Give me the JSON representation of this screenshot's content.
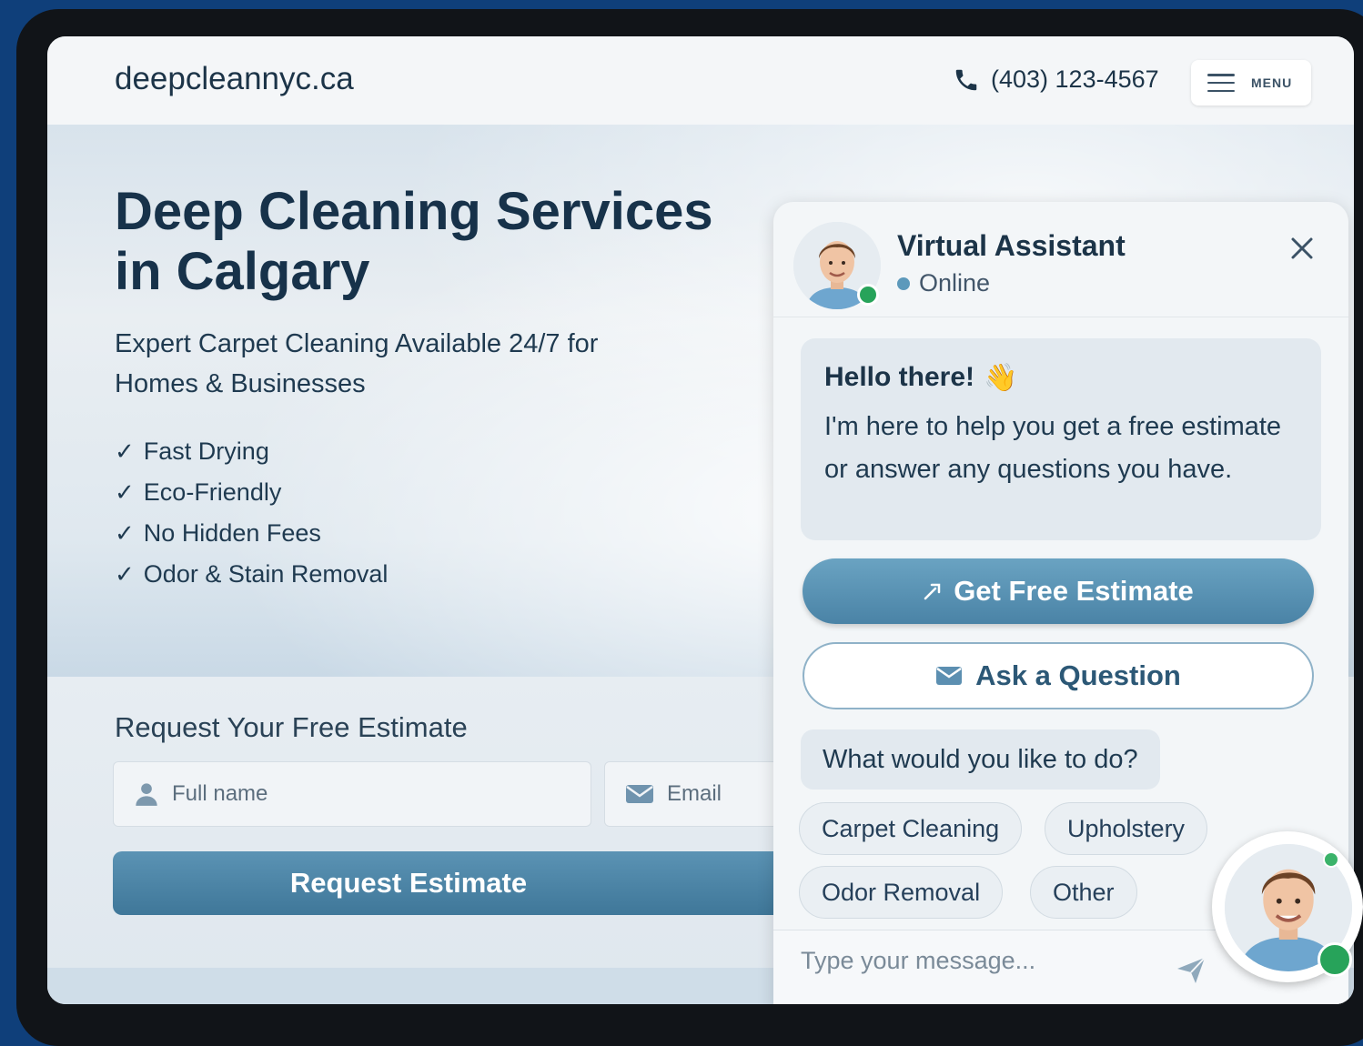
{
  "header": {
    "logo": "deepcleannyc.ca",
    "phone": "(403) 123-4567",
    "menu_label": "MENU"
  },
  "hero": {
    "title": "Deep Cleaning Services in Calgary",
    "subtitle": "Expert Carpet Cleaning Available 24/7 for Homes & Businesses",
    "features": [
      "Fast Drying",
      "Eco-Friendly",
      "No Hidden Fees",
      "Odor & Stain Removal"
    ]
  },
  "estimate_form": {
    "title": "Request Your Free Estimate",
    "name_placeholder": "Full name",
    "email_placeholder": "Email",
    "submit_label": "Request Estimate"
  },
  "chat": {
    "title": "Virtual Assistant",
    "status": "Online",
    "greeting": "Hello there!",
    "greeting_emoji": "👋",
    "message": "I'm here to help you get a free estimate or answer any questions you have.",
    "primary_button": "Get Free Estimate",
    "secondary_button": "Ask a Question",
    "prompt": "What would you like to do?",
    "options": [
      "Carpet Cleaning",
      "Upholstery",
      "Odor Removal",
      "Other"
    ],
    "input_placeholder": "Type your message..."
  },
  "colors": {
    "brand_dark": "#17324a",
    "accent": "#4a83a6",
    "online": "#27a35a",
    "page_bg": "#0f3f7a"
  },
  "icons": [
    "phone-icon",
    "menu-icon",
    "close-icon",
    "user-icon",
    "email-icon",
    "check-icon",
    "send-icon",
    "avatar-icon",
    "envelope-icon"
  ]
}
